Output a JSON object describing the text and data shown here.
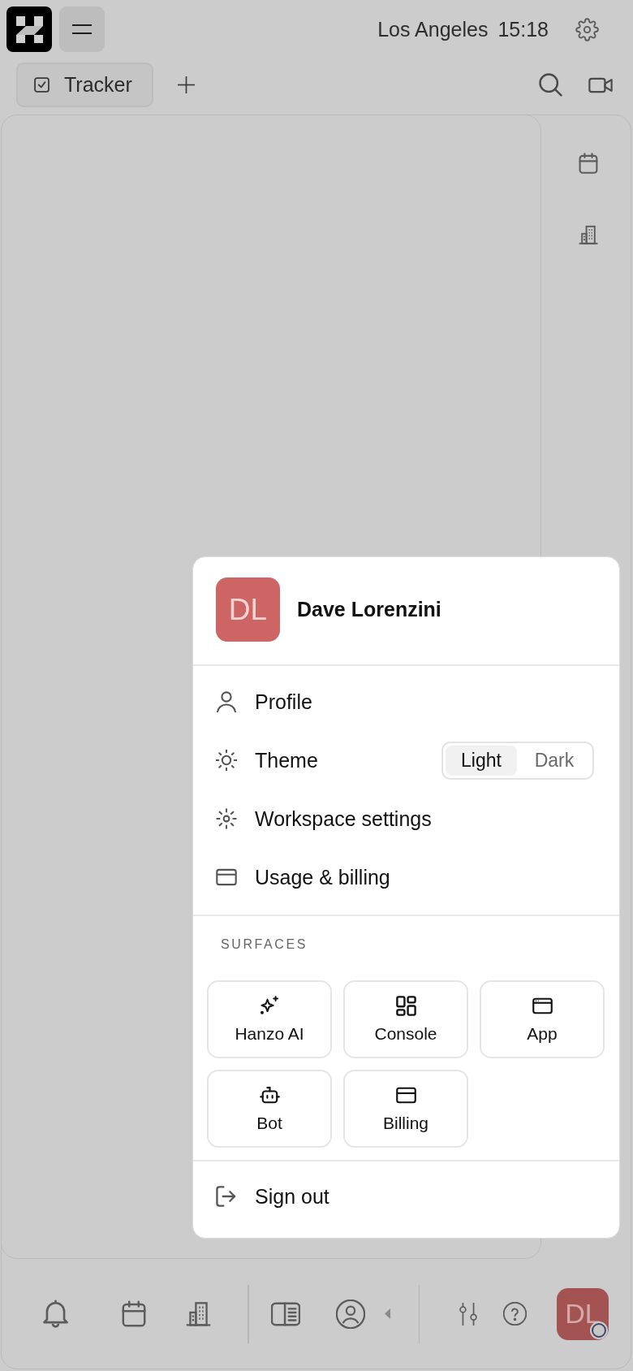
{
  "top_bar": {
    "city": "Los Angeles",
    "time": "15:18"
  },
  "tabs": [
    {
      "label": "Tracker",
      "selected": true
    }
  ],
  "bottom_bar": {
    "avatar_initials": "DL"
  },
  "user_menu": {
    "initials": "DL",
    "name": "Dave Lorenzini",
    "items": [
      {
        "kind": "link",
        "label": "Profile"
      },
      {
        "kind": "toggle",
        "label": "Theme",
        "options": [
          {
            "label": "Light",
            "selected": true
          },
          {
            "label": "Dark",
            "selected": false
          }
        ]
      },
      {
        "kind": "link",
        "label": "Workspace settings"
      },
      {
        "kind": "link",
        "label": "Usage & billing"
      }
    ],
    "surfaces_title": "SURFACES",
    "surfaces": [
      {
        "label": "Hanzo AI"
      },
      {
        "label": "Console"
      },
      {
        "label": "App"
      },
      {
        "label": "Bot"
      },
      {
        "label": "Billing"
      }
    ],
    "sign_out": "Sign out"
  }
}
